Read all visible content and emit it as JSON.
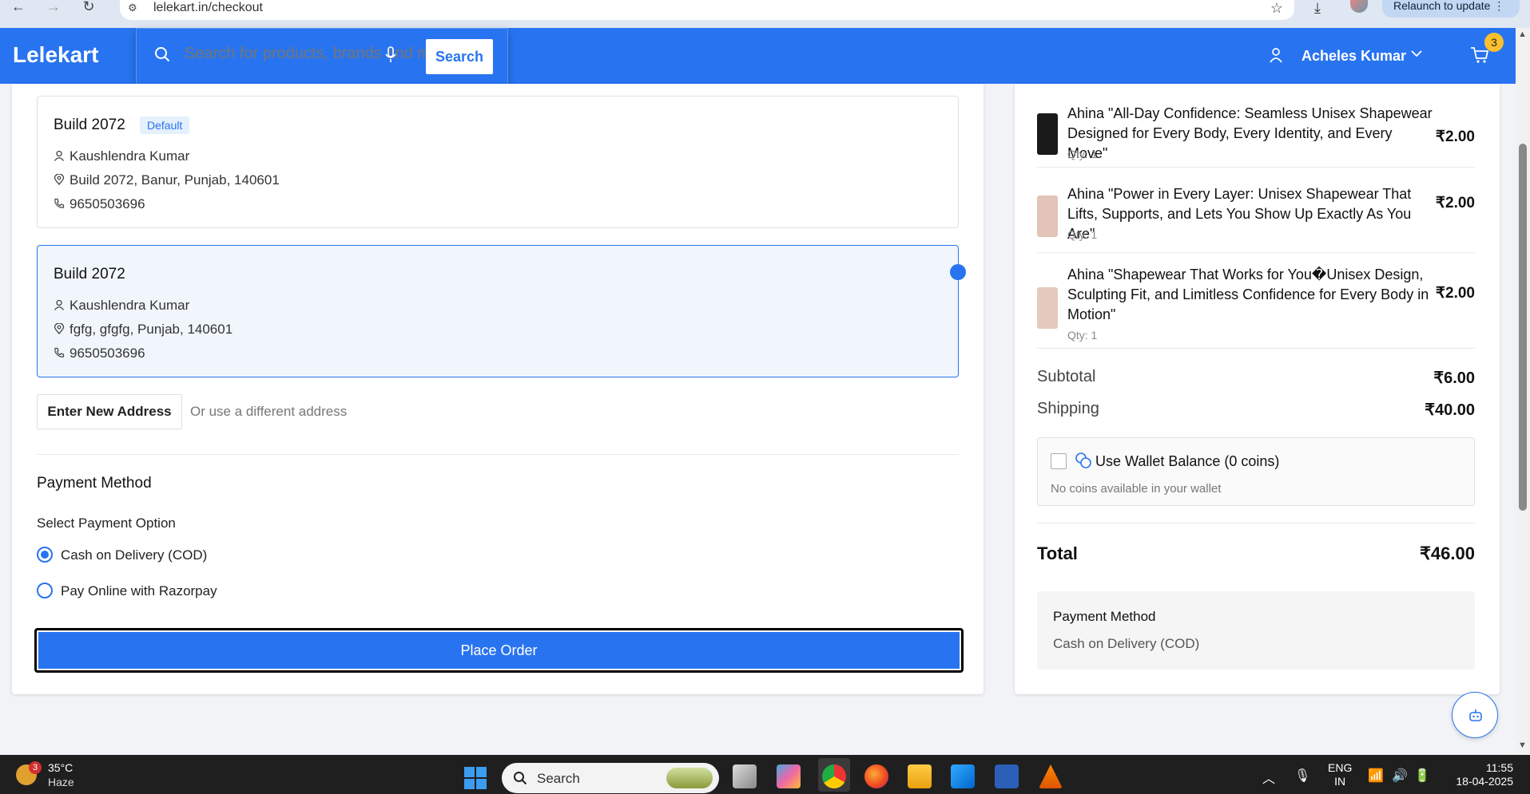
{
  "browser": {
    "url": "lelekart.in/checkout",
    "relaunch_label": "Relaunch to update"
  },
  "header": {
    "logo": "Lelekart",
    "search_placeholder": "Search for products, brands and more",
    "search_button": "Search",
    "user_name": "Acheles Kumar",
    "cart_count": "3",
    "brand_color": "#2874f0"
  },
  "addresses": [
    {
      "title": "Build 2072",
      "badge": "Default",
      "name": "Kaushlendra Kumar",
      "address": "Build 2072, Banur, Punjab, 140601",
      "phone": "9650503696",
      "selected": false
    },
    {
      "title": "Build 2072",
      "name": "Kaushlendra Kumar",
      "address": "fgfg, gfgfg, Punjab, 140601",
      "phone": "9650503696",
      "selected": true
    }
  ],
  "new_address": {
    "button": "Enter New Address",
    "hint": "Or use a different address"
  },
  "payment": {
    "title": "Payment Method",
    "select_label": "Select Payment Option",
    "options": [
      {
        "label": "Cash on Delivery (COD)",
        "selected": true
      },
      {
        "label": "Pay Online with Razorpay",
        "selected": false
      }
    ],
    "place_order": "Place Order"
  },
  "summary": {
    "items": [
      {
        "name": "Ahina \"All-Day Confidence: Seamless Unisex Shapewear Designed for Every Body, Every Identity, and Every Move\"",
        "qty": "Qty: 1",
        "price": "₹2.00",
        "thumb_color": "#1a1a1a"
      },
      {
        "name": "Ahina \"Power in Every Layer: Unisex Shapewear That Lifts, Supports, and Lets You Show Up Exactly As You Are\"",
        "qty": "Qty: 1",
        "price": "₹2.00",
        "thumb_color": "#e2c4b8"
      },
      {
        "name": "Ahina \"Shapewear That Works for You�Unisex Design, Sculpting Fit, and Limitless Confidence for Every Body in Motion\"",
        "qty": "Qty: 1",
        "price": "₹2.00",
        "thumb_color": "#e6c9bd"
      }
    ],
    "subtotal_label": "Subtotal",
    "subtotal": "₹6.00",
    "shipping_label": "Shipping",
    "shipping": "₹40.00",
    "wallet_label": "Use Wallet Balance (0 coins)",
    "wallet_note": "No coins available in your wallet",
    "total_label": "Total",
    "total": "₹46.00",
    "pm_title": "Payment Method",
    "pm_value": "Cash on Delivery (COD)"
  },
  "taskbar": {
    "weather_badge": "3",
    "temperature": "35°C",
    "condition": "Haze",
    "search": "Search",
    "lang_top": "ENG",
    "lang_bottom": "IN",
    "time": "11:55",
    "date": "18-04-2025"
  }
}
